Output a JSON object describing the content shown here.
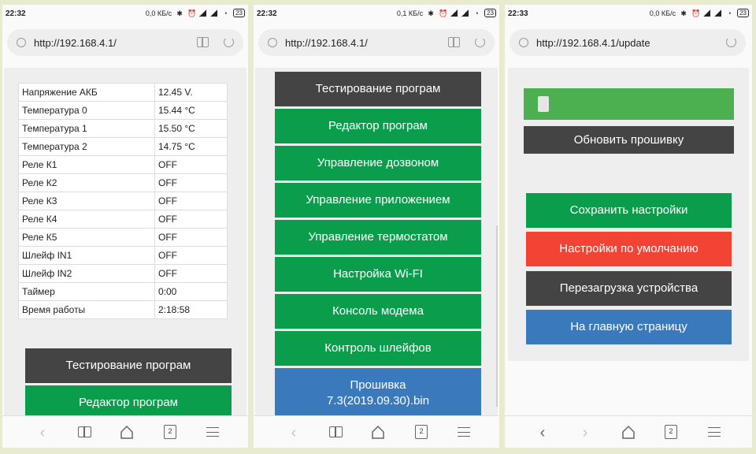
{
  "panel1": {
    "status": {
      "time": "22:32",
      "speed": "0,0 КБ/с",
      "battery": "23"
    },
    "url": "http://192.168.4.1/",
    "table": [
      {
        "key": "Напряжение АКБ",
        "value": "12.45 V."
      },
      {
        "key": "Температура 0",
        "value": "15.44 °C"
      },
      {
        "key": "Температура 1",
        "value": "15.50 °C"
      },
      {
        "key": "Температура 2",
        "value": "14.75 °C"
      },
      {
        "key": "Реле К1",
        "value": "OFF"
      },
      {
        "key": "Реле К2",
        "value": "OFF"
      },
      {
        "key": "Реле К3",
        "value": "OFF"
      },
      {
        "key": "Реле К4",
        "value": "OFF"
      },
      {
        "key": "Реле К5",
        "value": "OFF"
      },
      {
        "key": "Шлейф IN1",
        "value": "OFF"
      },
      {
        "key": "Шлейф IN2",
        "value": "OFF"
      },
      {
        "key": "Таймер",
        "value": "0:00"
      },
      {
        "key": "Время работы",
        "value": "2:18:58"
      }
    ],
    "buttons": [
      "Тестирование програм",
      "Редактор програм"
    ],
    "tab_count": "2"
  },
  "panel2": {
    "status": {
      "time": "22:32",
      "speed": "0,1 КБ/с",
      "battery": "23"
    },
    "url": "http://192.168.4.1/",
    "buttons": [
      "Тестирование програм",
      "Редактор програм",
      "Управление дозвоном",
      "Управление приложением",
      "Управление термостатом",
      "Настройка Wi-FI",
      "Консоль модема",
      "Контроль шлейфов",
      "Прошивка\n7.3(2019.09.30).bin"
    ],
    "tab_count": "2"
  },
  "panel3": {
    "status": {
      "time": "22:33",
      "speed": "0,0 КБ/с",
      "battery": "23"
    },
    "url": "http://192.168.4.1/update",
    "update_button": "Обновить прошивку",
    "buttons": [
      "Сохранить настройки",
      "Настройки по умолчанию",
      "Перезагрузка устройства",
      "На главную страницу"
    ],
    "tab_count": "2"
  },
  "colors": {
    "dark": "#444444",
    "green": "#0a9d4b",
    "blue": "#3b79bd",
    "red": "#f24335",
    "progress": "#4caf50",
    "frame": "#e9ebcf"
  },
  "icons": [
    "globe-icon",
    "reader-mode-icon",
    "reload-icon",
    "back-icon",
    "forward-icon",
    "bookmarks-icon",
    "home-icon",
    "tabs-icon",
    "menu-icon",
    "bluetooth-icon",
    "alarm-icon",
    "signal-icon",
    "wifi-icon",
    "battery-icon"
  ]
}
